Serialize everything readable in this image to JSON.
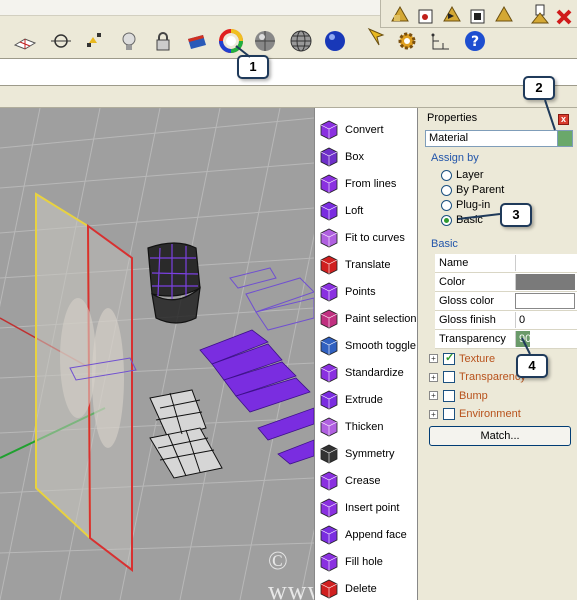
{
  "toolbar": {
    "top_icons": [
      "grid-icon",
      "snap-icon",
      "points-icon",
      "lightbulb-icon",
      "lock-icon",
      "material-icon",
      "color-wheel-icon",
      "sphere-shaded-icon",
      "sphere-wire-icon",
      "sphere-blue-icon"
    ],
    "right_icons": [
      "cursor-icon",
      "gear-icon",
      "dims-icon",
      "help-icon"
    ],
    "panel_icons": [
      "layer-icon-1",
      "layer-icon-2",
      "layer-icon-3",
      "layer-icon-4",
      "layer-icon-5",
      "layer-icon-6"
    ]
  },
  "tools": [
    {
      "label": "Convert",
      "icon": "convert-icon"
    },
    {
      "label": "Box",
      "icon": "box-icon"
    },
    {
      "label": "From lines",
      "icon": "from-lines-icon"
    },
    {
      "label": "Loft",
      "icon": "loft-icon"
    },
    {
      "label": "Fit to curves",
      "icon": "fit-curves-icon"
    },
    {
      "label": "Translate",
      "icon": "translate-icon"
    },
    {
      "label": "Points",
      "icon": "points-icon"
    },
    {
      "label": "Paint selection",
      "icon": "paint-selection-icon"
    },
    {
      "label": "Smooth toggle",
      "icon": "smooth-toggle-icon"
    },
    {
      "label": "Standardize",
      "icon": "standardize-icon"
    },
    {
      "label": "Extrude",
      "icon": "extrude-icon"
    },
    {
      "label": "Thicken",
      "icon": "thicken-icon"
    },
    {
      "label": "Symmetry",
      "icon": "symmetry-icon"
    },
    {
      "label": "Crease",
      "icon": "crease-icon"
    },
    {
      "label": "Insert point",
      "icon": "insert-point-icon"
    },
    {
      "label": "Append face",
      "icon": "append-face-icon"
    },
    {
      "label": "Fill hole",
      "icon": "fill-hole-icon"
    },
    {
      "label": "Delete",
      "icon": "delete-icon"
    }
  ],
  "properties": {
    "title": "Properties",
    "close": "x",
    "material_value": "Material",
    "assign_by_label": "Assign by",
    "assign_options": [
      {
        "label": "Layer",
        "checked": false
      },
      {
        "label": "By Parent",
        "checked": false
      },
      {
        "label": "Plug-in",
        "checked": false
      },
      {
        "label": "Basic",
        "checked": true
      }
    ],
    "basic_label": "Basic",
    "rows": [
      {
        "key": "Name",
        "value": ""
      },
      {
        "key": "Color",
        "value": ""
      },
      {
        "key": "Gloss color",
        "value": ""
      },
      {
        "key": "Gloss finish",
        "value": "0"
      },
      {
        "key": "Transparency",
        "value": "90"
      }
    ],
    "colors": {
      "color_swatch": "#7a7a7a",
      "gloss_swatch": "#ffffff"
    },
    "tree": [
      {
        "label": "Texture",
        "checked": true
      },
      {
        "label": "Transparency",
        "checked": false
      },
      {
        "label": "Bump",
        "checked": false
      },
      {
        "label": "Environment",
        "checked": false
      }
    ],
    "match_label": "Match..."
  },
  "callouts": [
    "1",
    "2",
    "3",
    "4"
  ],
  "watermark": "© www.season.ru"
}
